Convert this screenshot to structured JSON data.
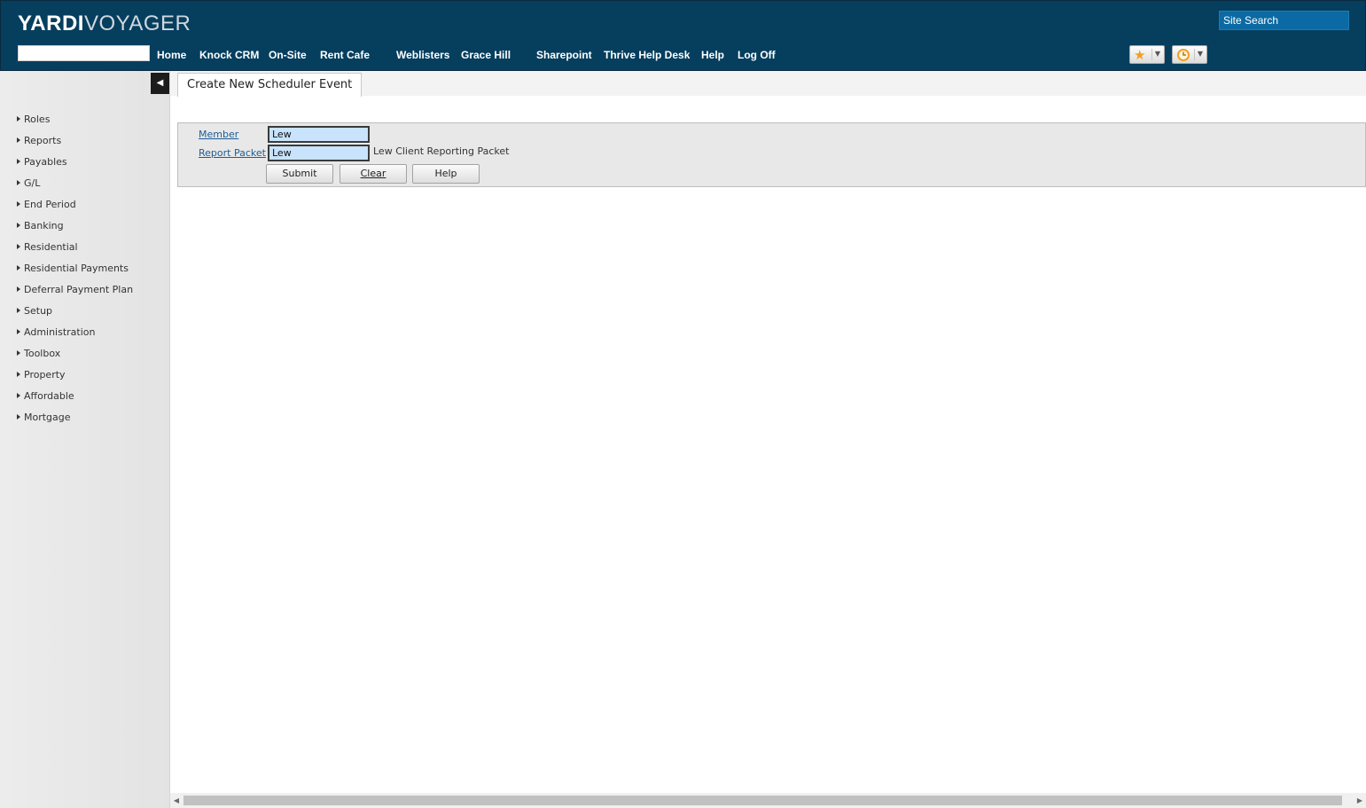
{
  "header": {
    "logo_bold": "YARDI",
    "logo_light": "VOYAGER",
    "site_search_placeholder": "Site Search",
    "header_input_value": "",
    "nav": [
      {
        "label": "Home"
      },
      {
        "label": "Knock CRM"
      },
      {
        "label": "On-Site"
      },
      {
        "label": "Rent Cafe"
      },
      {
        "label": "Weblisters"
      },
      {
        "label": "Grace Hill"
      },
      {
        "label": "Sharepoint"
      },
      {
        "label": "Thrive Help Desk"
      },
      {
        "label": "Help"
      },
      {
        "label": "Log Off"
      }
    ],
    "favorites_icon": "star-icon",
    "history_icon": "clock-icon",
    "colors": {
      "header_bg": "#063e5e",
      "search_bg": "#0b6aa3",
      "star": "#f0a020",
      "clock": "#f0a020"
    }
  },
  "sidebar": {
    "collapse_icon": "collapse-left-icon",
    "items": [
      {
        "label": "Roles"
      },
      {
        "label": "Reports"
      },
      {
        "label": "Payables"
      },
      {
        "label": "G/L"
      },
      {
        "label": "End Period"
      },
      {
        "label": "Banking"
      },
      {
        "label": "Residential"
      },
      {
        "label": "Residential Payments"
      },
      {
        "label": "Deferral Payment Plan"
      },
      {
        "label": "Setup"
      },
      {
        "label": "Administration"
      },
      {
        "label": "Toolbox"
      },
      {
        "label": "Property"
      },
      {
        "label": "Affordable"
      },
      {
        "label": "Mortgage"
      }
    ]
  },
  "main": {
    "tab_title": "Create New Scheduler Event",
    "form": {
      "member_label": "Member",
      "member_value": "Lew",
      "report_packet_label": "Report Packet",
      "report_packet_value": "Lew",
      "report_packet_description": "Lew Client Reporting Packet",
      "buttons": {
        "submit": "Submit",
        "clear": "Clear",
        "help": "Help"
      }
    }
  }
}
